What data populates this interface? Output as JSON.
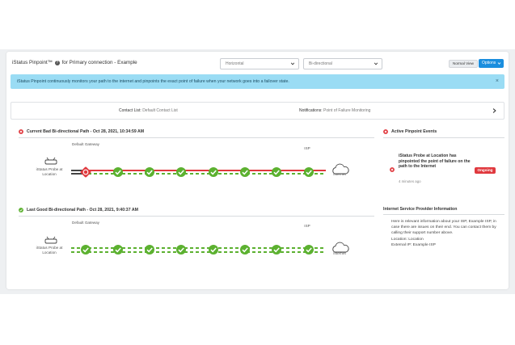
{
  "header": {
    "title": "iStatus Pinpoint™",
    "title_suffix": "for Primary connection - Example",
    "help_icon": "?",
    "layout_select": "Horizontal",
    "direction_select": "Bi-directional",
    "normal_view_label": "Normal View",
    "options_label": "Options"
  },
  "alert": {
    "text": "iStatus Pinpoint continuously monitors your path to the internet and pinpoints the exact point of failure when your network goes into a failover state.",
    "close": "×"
  },
  "contact": {
    "list_label": "Contact List:",
    "list_value": "Default Contact List",
    "notif_label": "Notifications:",
    "notif_value": "Point of Failure Monitoring"
  },
  "current_path": {
    "heading": "Current Bad Bi-directional Path - Oct 28, 2021, 10:34:59 AM",
    "status": "bad",
    "gateway_label": "Default Gateway",
    "isp_label": "ISP",
    "probe_label": "iStatus Probe at Location",
    "internet_label": "Internet",
    "hops": [
      "fail",
      "ok",
      "ok",
      "ok",
      "ok",
      "ok",
      "ok",
      "ok"
    ]
  },
  "last_good_path": {
    "heading": "Last Good Bi-directional Path - Oct 28, 2021, 9:40:37 AM",
    "status": "good",
    "gateway_label": "Default Gateway",
    "isp_label": "ISP",
    "probe_label": "iStatus Probe at Location",
    "internet_label": "Internet",
    "hops": [
      "ok",
      "ok",
      "ok",
      "ok",
      "ok",
      "ok",
      "ok",
      "ok"
    ]
  },
  "events": {
    "heading": "Active Pinpoint Events",
    "items": [
      {
        "text": "iStatus Probe at Location has pinpointed the point of failure on the path to the Internet",
        "time": "4 minutes ago",
        "badge": "Ongoing"
      }
    ]
  },
  "isp_info": {
    "heading": "Internet Service Provider Information",
    "text": "Here is relevant information about your ISP, Example ISP, in case there are issues on their end. You can contact them by calling their support number above.",
    "location": "Location: Location",
    "external_ip": "External IP: Example ISP"
  },
  "colors": {
    "ok": "#5cb130",
    "fail": "#e0393e",
    "accent": "#1b8ede",
    "alert_bg": "#9adcf4"
  }
}
